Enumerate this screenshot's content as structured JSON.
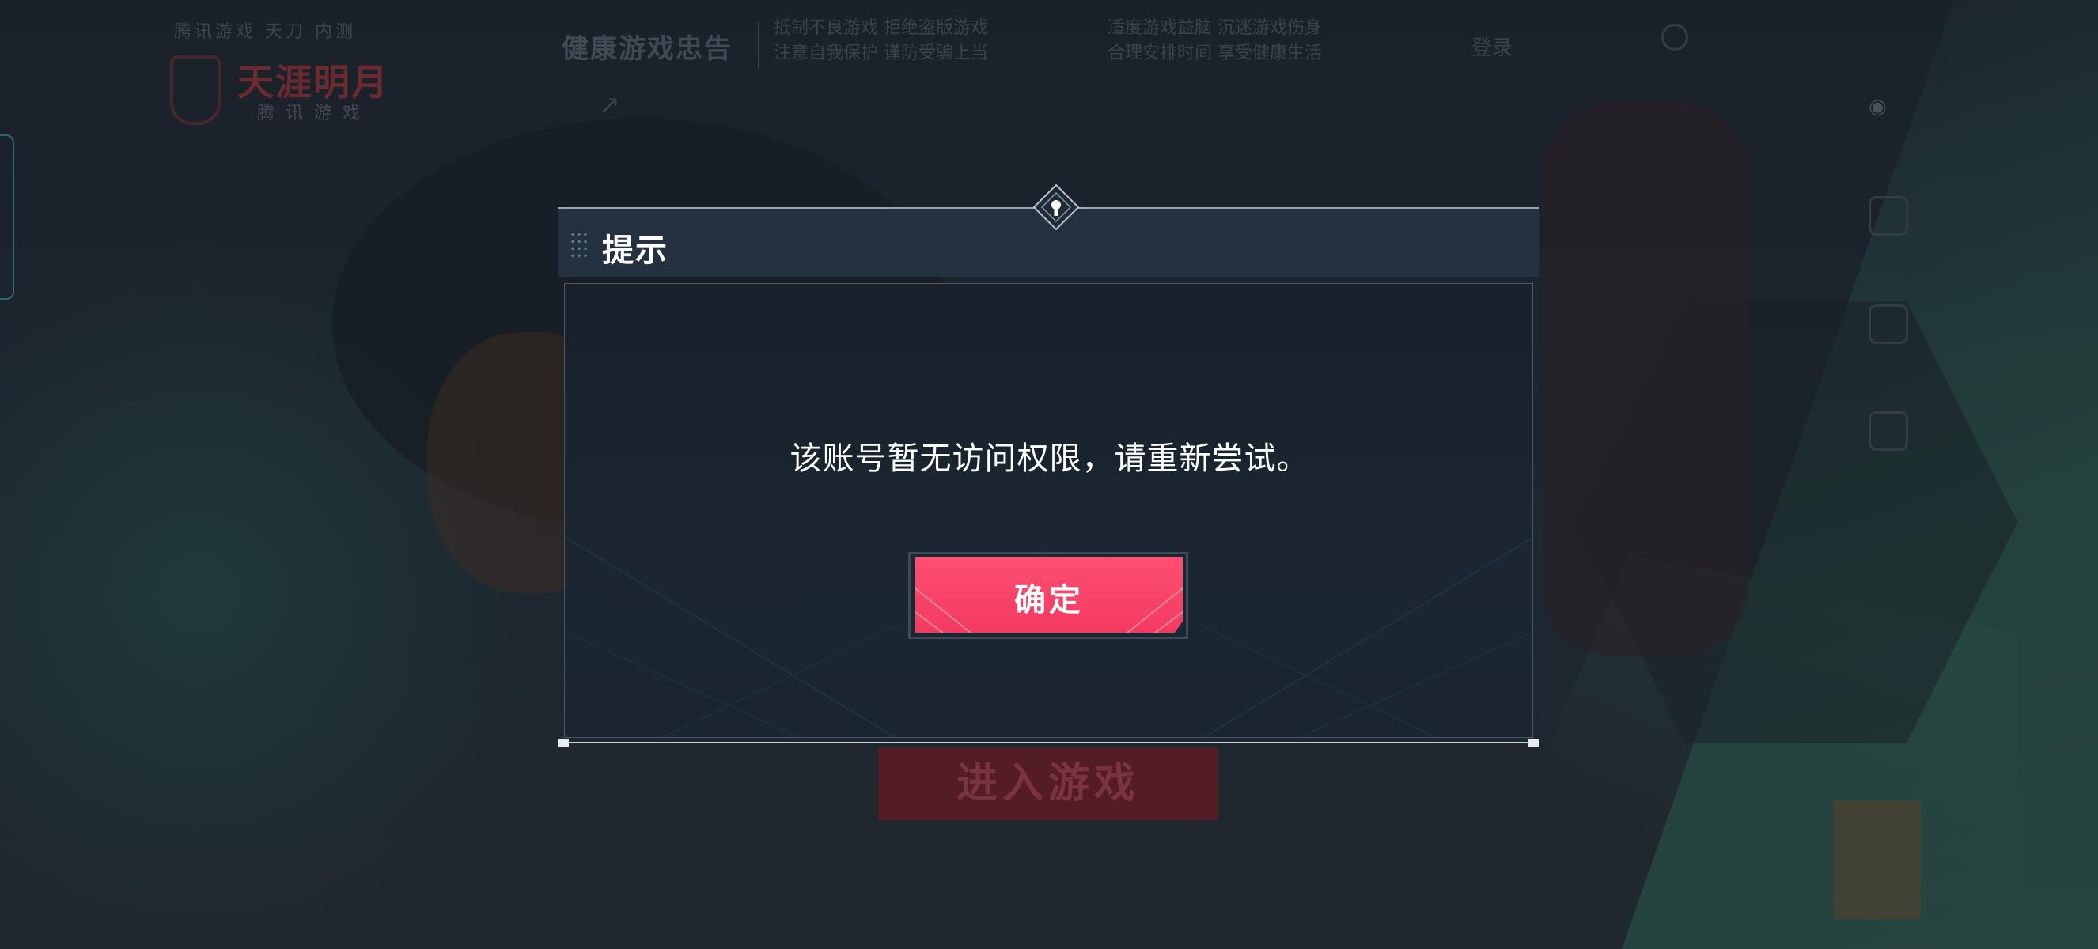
{
  "background": {
    "top_line": "腾讯游戏 天刀 内测",
    "logo_text": "天涯明月",
    "logo_sub": "腾讯游戏",
    "nav_title": "健康游戏忠告",
    "notices": [
      "抵制不良游戏  拒绝盗版游戏",
      "注意自我保护  谨防受骗上当",
      "适度游戏益脑  沉迷游戏伤身",
      "合理安排时间  享受健康生活"
    ],
    "nav_right": "登录",
    "start_button": "进入游戏"
  },
  "dialog": {
    "title": "提示",
    "message": "该账号暂无访问权限，请重新尝试。",
    "confirm_label": "确定",
    "colors": {
      "header": "#243141",
      "body": "#1b2631",
      "button": "#f23a60",
      "text": "#ffffff"
    },
    "icons": [
      "drag-grip-icon",
      "diamond-emblem-icon"
    ]
  }
}
